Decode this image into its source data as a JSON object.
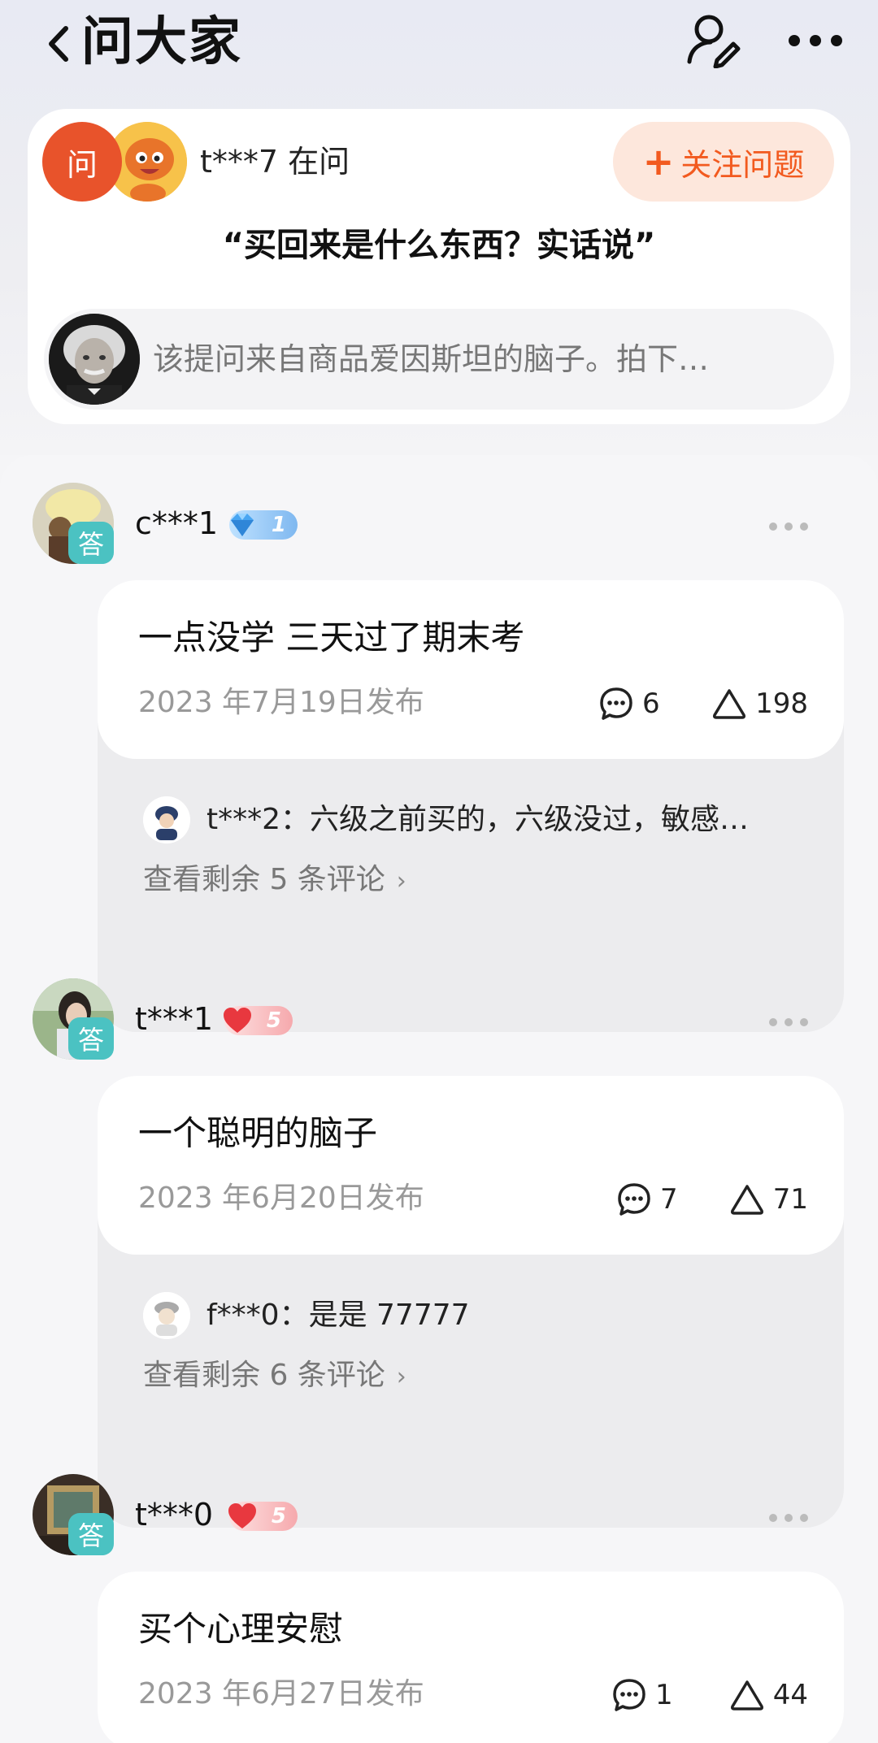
{
  "nav": {
    "title": "问大家"
  },
  "question": {
    "ask_badge": "问",
    "asker": "t***7 在问",
    "follow_label": "关注问题",
    "follow_plus": "+",
    "text": "“买回来是什么东西？实话说”",
    "source": "该提问来自商品爱因斯坦的脑子。拍下…"
  },
  "answers": [
    {
      "name": "c***1",
      "badge": "答",
      "level": "1",
      "level_type": "diamond",
      "text": "一点没学 三天过了期末考",
      "date": "2023 年7月19日发布",
      "comments": "6",
      "likes": "198",
      "reply": "t***2：六级之前买的，六级没过，敏感…",
      "view_more": "查看剩余 5 条评论"
    },
    {
      "name": "t***1",
      "badge": "答",
      "level": "5",
      "level_type": "heart",
      "text": "一个聪明的脑子",
      "date": "2023 年6月20日发布",
      "comments": "7",
      "likes": "71",
      "reply": "f***0：是是 77777",
      "view_more": "查看剩余 6 条评论"
    },
    {
      "name": "t***0",
      "badge": "答",
      "level": "5",
      "level_type": "heart",
      "text": "买个心理安慰",
      "date": "2023 年6月27日发布",
      "comments": "1",
      "likes": "44"
    }
  ],
  "colors": {
    "accent": "#f25a1f",
    "ask_badge": "#e8532b",
    "answer_badge": "#4bc2c2"
  },
  "icons": [
    "back-chevron-icon",
    "user-edit-icon",
    "more-horizontal-icon",
    "comment-icon",
    "like-triangle-icon",
    "chevron-right-icon"
  ]
}
